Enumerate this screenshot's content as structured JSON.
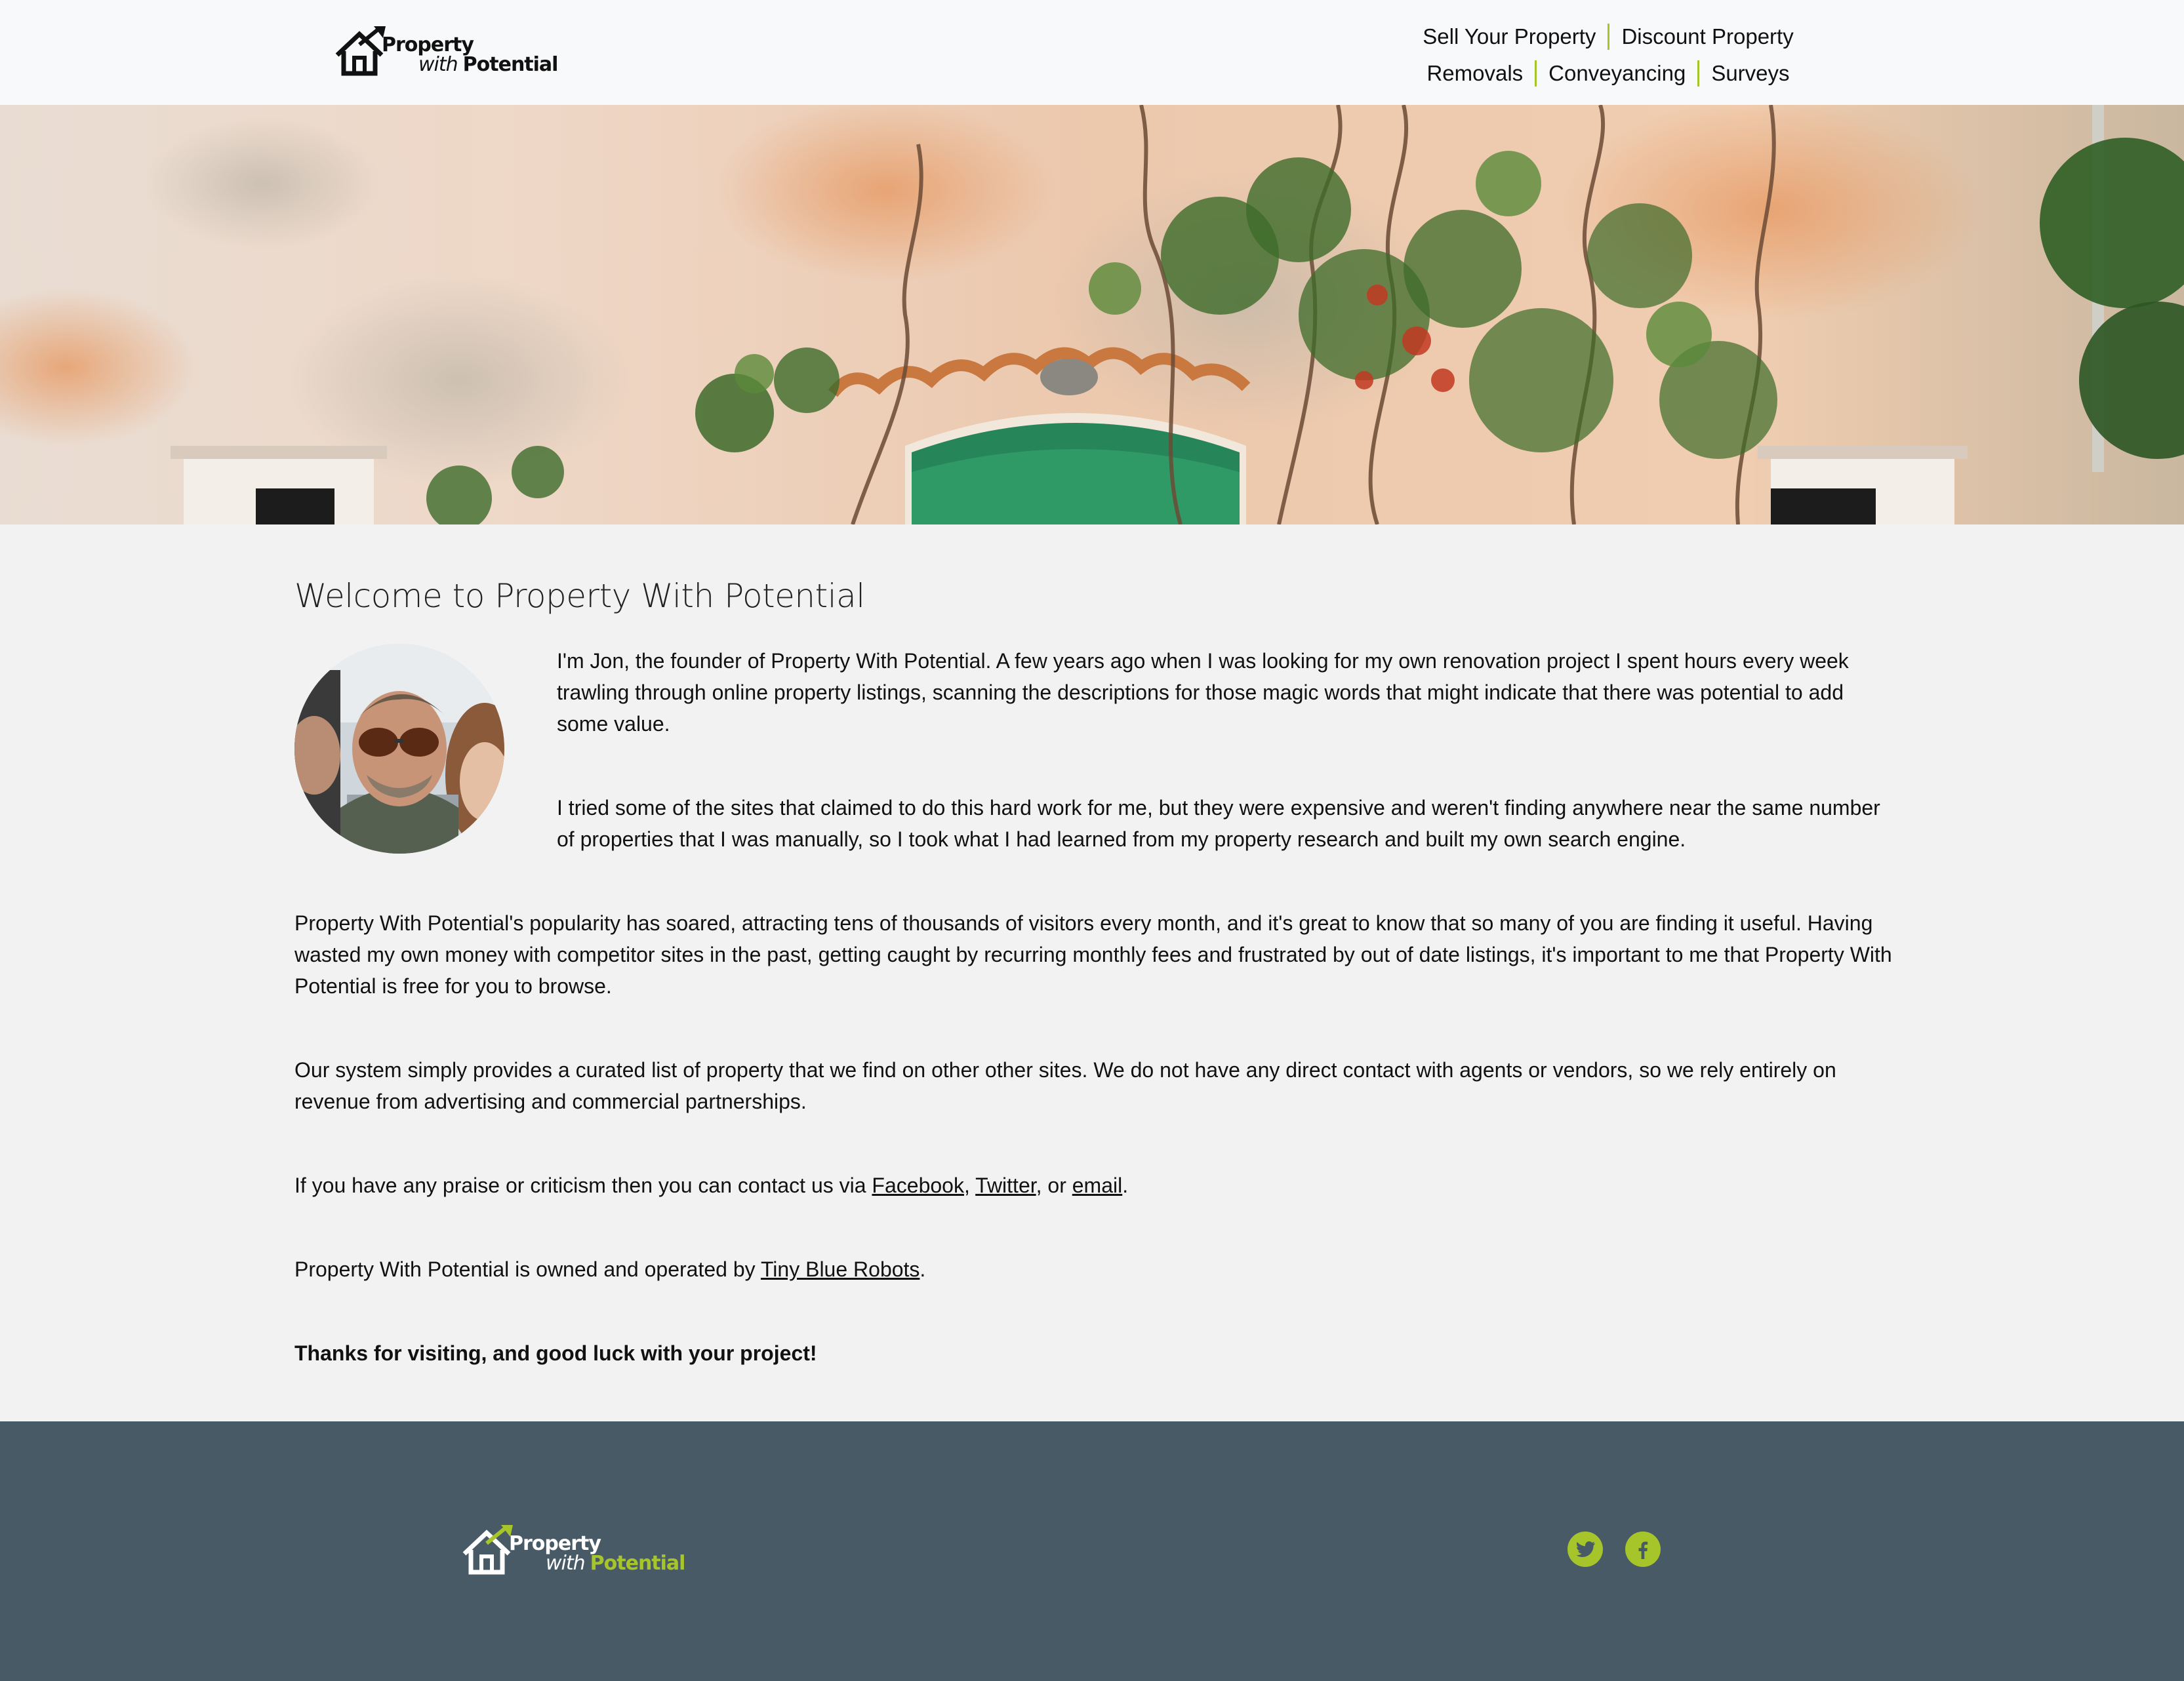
{
  "header": {
    "logo": {
      "line1": "Property",
      "with": "with",
      "potential": "Potential"
    },
    "nav": [
      {
        "label": "Sell Your Property"
      },
      {
        "label": "Discount Property"
      },
      {
        "label": "Removals"
      },
      {
        "label": "Conveyancing"
      },
      {
        "label": "Surveys"
      }
    ]
  },
  "main": {
    "title": "Welcome to Property With Potential",
    "p1": "I'm Jon, the founder of Property With Potential. A few years ago when I was looking for my own renovation project I spent hours every week trawling through online property listings, scanning the descriptions for those magic words that might indicate that there was potential to add some value.",
    "p2": "I tried some of the sites that claimed to do this hard work for me, but they were expensive and weren't finding anywhere near the same number of properties that I was manually, so I took what I had learned from my property research and built my own search engine.",
    "p3": "Property With Potential's popularity has soared, attracting tens of thousands of visitors every month, and it's great to know that so many of you are finding it useful. Having wasted my own money with competitor sites in the past, getting caught by recurring monthly fees and frustrated by out of date listings, it's important to me that Property With Potential is free for you to browse.",
    "p4": "Our system simply provides a curated list of property that we find on other other sites. We do not have any direct contact with agents or vendors, so we rely entirely on revenue from advertising and commercial partnerships.",
    "contact": {
      "before": "If you have any praise or criticism then you can contact us via ",
      "facebook": "Facebook",
      "comma1": ", ",
      "twitter": "Twitter",
      "or": ", or ",
      "email": "email",
      "end": "."
    },
    "owned": {
      "before": "Property With Potential is owned and operated by ",
      "link": "Tiny Blue Robots",
      "end": "."
    },
    "thanks": "Thanks for visiting, and good luck with your project!"
  },
  "footer": {
    "logo": {
      "line1": "Property",
      "with": "with",
      "potential": "Potential"
    },
    "social": [
      {
        "icon": "twitter-icon"
      },
      {
        "icon": "facebook-icon"
      }
    ]
  },
  "colors": {
    "accent": "#a6c52a",
    "footer_bg": "#475a66",
    "page_bg": "#f2f2f2",
    "header_bg": "#f8f9fa"
  }
}
